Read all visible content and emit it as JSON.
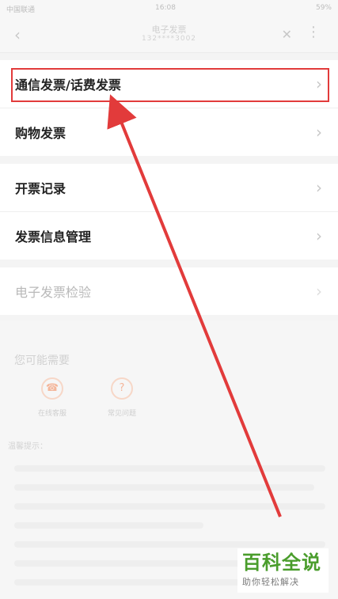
{
  "status": {
    "left": "中国联通",
    "time": "16:08",
    "right": "59%"
  },
  "nav": {
    "title": "电子发票",
    "subtitle": "132****3002"
  },
  "group1": [
    {
      "label": "通信发票/话费发票"
    },
    {
      "label": "购物发票"
    }
  ],
  "group2": [
    {
      "label": "开票记录"
    },
    {
      "label": "发票信息管理"
    }
  ],
  "group3": [
    {
      "label": "电子发票检验"
    }
  ],
  "panel": {
    "section": "您可能需要",
    "notice": "温馨提示：",
    "shortcuts": [
      {
        "label": "在线客服"
      },
      {
        "label": "常见问题"
      }
    ]
  },
  "watermark": {
    "title": "百科全说",
    "subtitle": "助你轻松解决"
  },
  "colors": {
    "highlight": "#e23b3b",
    "watermark": "#4a9d2c"
  }
}
